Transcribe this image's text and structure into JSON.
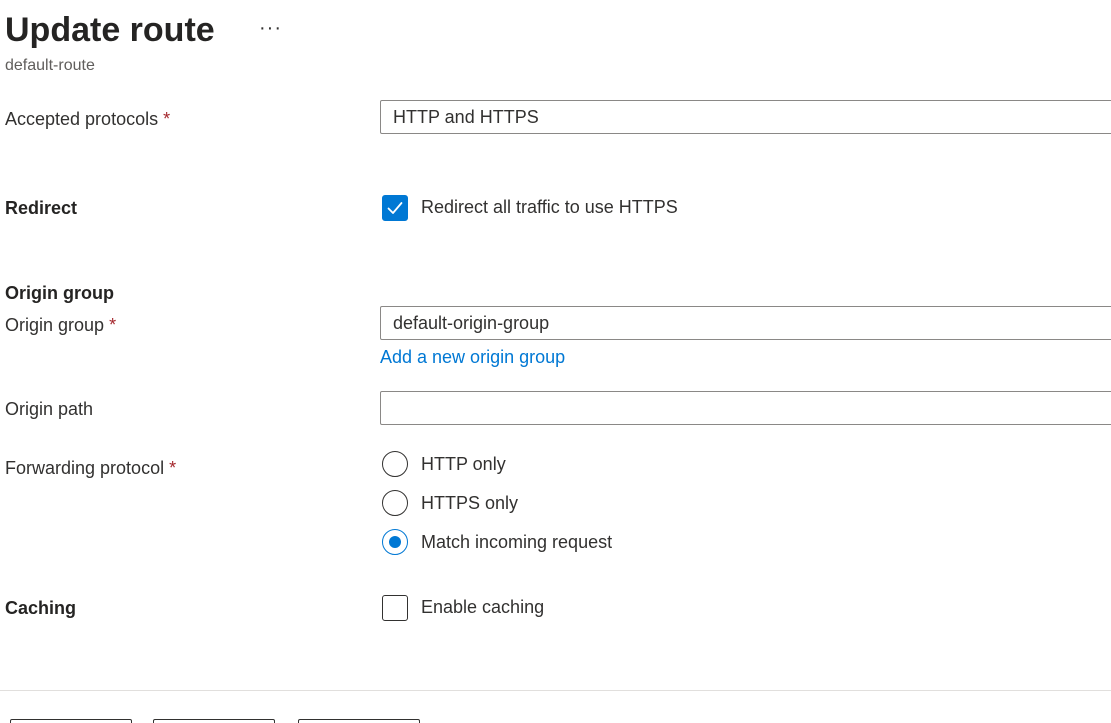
{
  "header": {
    "title": "Update route",
    "more_label": "···",
    "subtitle": "default-route"
  },
  "form": {
    "accepted_protocols": {
      "label": "Accepted protocols",
      "required_mark": "*",
      "value": "HTTP and HTTPS"
    },
    "redirect": {
      "label": "Redirect",
      "checkbox_label": "Redirect all traffic to use HTTPS",
      "checked": true
    },
    "origin_section": {
      "heading": "Origin group"
    },
    "origin_group": {
      "label": "Origin group",
      "required_mark": "*",
      "value": "default-origin-group",
      "add_link": "Add a new origin group"
    },
    "origin_path": {
      "label": "Origin path",
      "value": ""
    },
    "forwarding_protocol": {
      "label": "Forwarding protocol",
      "required_mark": "*",
      "options": [
        "HTTP only",
        "HTTPS only",
        "Match incoming request"
      ],
      "selected": "Match incoming request"
    },
    "caching": {
      "label": "Caching",
      "checkbox_label": "Enable caching",
      "checked": false
    }
  },
  "colors": {
    "accent": "#0078d4",
    "required": "#a4262c",
    "border": "#8a8886"
  }
}
